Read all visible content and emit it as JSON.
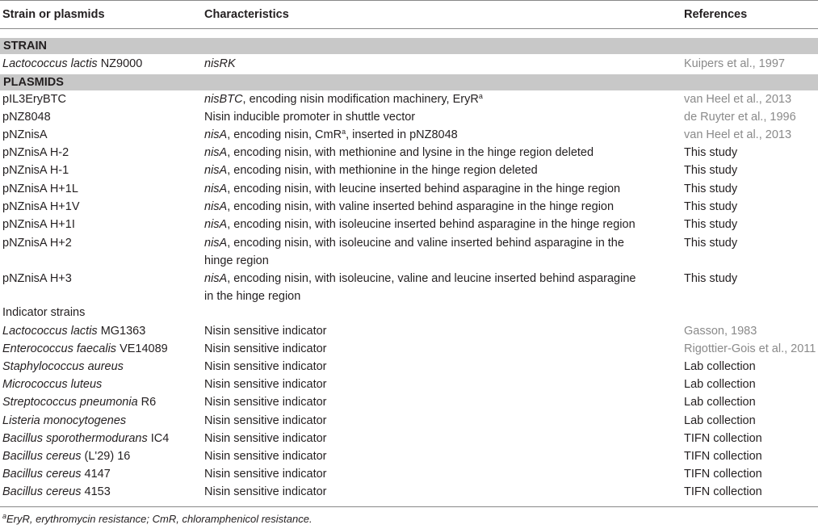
{
  "header": {
    "col1": "Strain or plasmids",
    "col2": "Characteristics",
    "col3": "References"
  },
  "sections": {
    "strain": "STRAIN",
    "plasmids": "PLASMIDS"
  },
  "strain_row": {
    "name_italic": "Lactococcus lactis",
    "name_rest": " NZ9000",
    "char_italic": "nisRK",
    "ref": "Kuipers et al., 1997"
  },
  "plasmid_rows": [
    {
      "name": "pIL3EryBTC",
      "char_italic": "nisBTC",
      "char_rest": ", encoding nisin modification machinery, EryR",
      "sup": "a",
      "ref": "van Heel et al., 2013"
    },
    {
      "name": "pNZ8048",
      "char_italic": "",
      "char_rest": "Nisin inducible promoter in shuttle vector",
      "ref": "de Ruyter et al., 1996"
    },
    {
      "name": "pNZnisA",
      "char_italic": "nisA",
      "char_rest": ", encoding nisin, CmR",
      "sup": "a",
      "char_after": ", inserted in pNZ8048",
      "ref": "van Heel et al., 2013"
    },
    {
      "name": "pNZnisA H-2",
      "char_italic": "nisA",
      "char_rest": ", encoding nisin, with methionine and lysine in the hinge region deleted",
      "ref": "This study"
    },
    {
      "name": "pNZnisA H-1",
      "char_italic": "nisA",
      "char_rest": ", encoding nisin, with methionine in the hinge region deleted",
      "ref": "This study"
    },
    {
      "name": "pNZnisA H+1L",
      "char_italic": "nisA",
      "char_rest": ", encoding nisin, with leucine inserted behind asparagine in the hinge region",
      "ref": "This study"
    },
    {
      "name": "pNZnisA H+1V",
      "char_italic": "nisA",
      "char_rest": ", encoding nisin, with valine inserted behind asparagine in the hinge region",
      "ref": "This study"
    },
    {
      "name": "pNZnisA H+1I",
      "char_italic": "nisA",
      "char_rest": ", encoding nisin, with isoleucine inserted behind asparagine in the hinge region",
      "ref": "This study"
    },
    {
      "name": "pNZnisA H+2",
      "char_italic": "nisA",
      "char_rest": ", encoding nisin, with isoleucine and valine inserted behind asparagine in the",
      "char_line2": "hinge region",
      "ref": "This study"
    },
    {
      "name": "pNZnisA H+3",
      "char_italic": "nisA",
      "char_rest": ", encoding nisin, with isoleucine, valine and leucine inserted behind asparagine",
      "char_line2": "in the hinge region",
      "ref": "This study"
    }
  ],
  "indicator_heading": "Indicator strains",
  "indicator_rows": [
    {
      "name_italic": "Lactococcus lactis",
      "name_rest": " MG1363",
      "char": "Nisin sensitive indicator",
      "ref": "Gasson, 1983"
    },
    {
      "name_italic": "Enterococcus faecalis",
      "name_rest": " VE14089",
      "char": "Nisin sensitive indicator",
      "ref": "Rigottier-Gois et al., 2011"
    },
    {
      "name_italic": "Staphylococcus aureus",
      "name_rest": "",
      "char": "Nisin sensitive indicator",
      "ref": "Lab collection"
    },
    {
      "name_italic": "Micrococcus luteus",
      "name_rest": "",
      "char": "Nisin sensitive indicator",
      "ref": "Lab collection"
    },
    {
      "name_italic": "Streptococcus pneumonia",
      "name_rest": " R6",
      "char": "Nisin sensitive indicator",
      "ref": "Lab collection"
    },
    {
      "name_italic": "Listeria monocytogenes",
      "name_rest": "",
      "char": "Nisin sensitive indicator",
      "ref": "Lab collection"
    },
    {
      "name_italic": "Bacillus sporothermodurans",
      "name_rest": " IC4",
      "char": "Nisin sensitive indicator",
      "ref": "TIFN collection"
    },
    {
      "name_italic": "Bacillus cereus",
      "name_rest": " (L'29) 16",
      "char": "Nisin sensitive indicator",
      "ref": "TIFN collection"
    },
    {
      "name_italic": "Bacillus cereus",
      "name_rest": " 4147",
      "char": "Nisin sensitive indicator",
      "ref": "TIFN collection"
    },
    {
      "name_italic": "Bacillus cereus",
      "name_rest": " 4153",
      "char": "Nisin sensitive indicator",
      "ref": "TIFN collection"
    }
  ],
  "footnote": {
    "sup": "a",
    "text": "EryR, erythromycin resistance; CmR, chloramphenicol resistance."
  },
  "colors": {
    "band": "#c8c8c8",
    "ref_gray": "#8a8a8a",
    "text": "#231f20"
  }
}
